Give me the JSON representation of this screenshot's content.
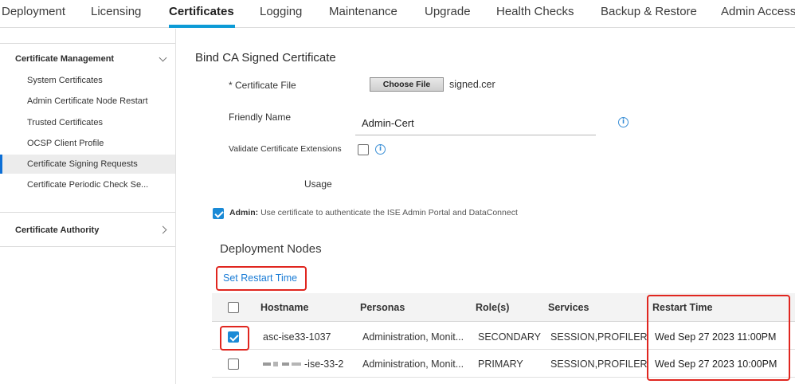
{
  "topnav": {
    "tabs": [
      "Deployment",
      "Licensing",
      "Certificates",
      "Logging",
      "Maintenance",
      "Upgrade",
      "Health Checks",
      "Backup & Restore",
      "Admin Access"
    ],
    "active": "Certificates"
  },
  "sidebar": {
    "sections": [
      {
        "label": "Certificate Management",
        "items": [
          "System Certificates",
          "Admin Certificate Node Restart",
          "Trusted Certificates",
          "OCSP Client Profile",
          "Certificate Signing Requests",
          "Certificate Periodic Check Se..."
        ]
      },
      {
        "label": "Certificate Authority"
      }
    ],
    "active_item": "Certificate Signing Requests"
  },
  "form": {
    "title": "Bind CA Signed Certificate",
    "certificate_file_label": "* Certificate File",
    "choose_file_label": "Choose File",
    "file_name": "signed.cer",
    "friendly_name_label": "Friendly Name",
    "friendly_name_value": "Admin-Cert",
    "validate_label": "Validate Certificate Extensions",
    "usage_label": "Usage",
    "admin_label": "Admin:",
    "admin_desc": "Use certificate to authenticate the ISE Admin Portal and DataConnect"
  },
  "deployment": {
    "title": "Deployment Nodes",
    "set_restart_link": "Set Restart Time",
    "columns": [
      "Hostname",
      "Personas",
      "Role(s)",
      "Services",
      "Restart Time"
    ],
    "rows": [
      {
        "checked": true,
        "hostname": "asc-ise33-1037",
        "personas": "Administration, Monit...",
        "role": "SECONDARY",
        "services": "SESSION,PROFILER",
        "restart_time": "Wed Sep 27 2023 11:00PM"
      },
      {
        "checked": false,
        "hostname": "-ise-33-2",
        "personas": "Administration, Monit...",
        "role": "PRIMARY",
        "services": "SESSION,PROFILER",
        "restart_time": "Wed Sep 27 2023 10:00PM"
      }
    ]
  },
  "icons": {
    "info": "info-icon",
    "chevron_down": "chevron-down-icon",
    "chevron_right": "chevron-right-icon",
    "checkbox": "checkbox"
  },
  "colors": {
    "accent": "#0d9bd6",
    "link": "#1a7cd6",
    "highlight": "#e0261f",
    "checkbox_checked": "#1a8ad6"
  }
}
